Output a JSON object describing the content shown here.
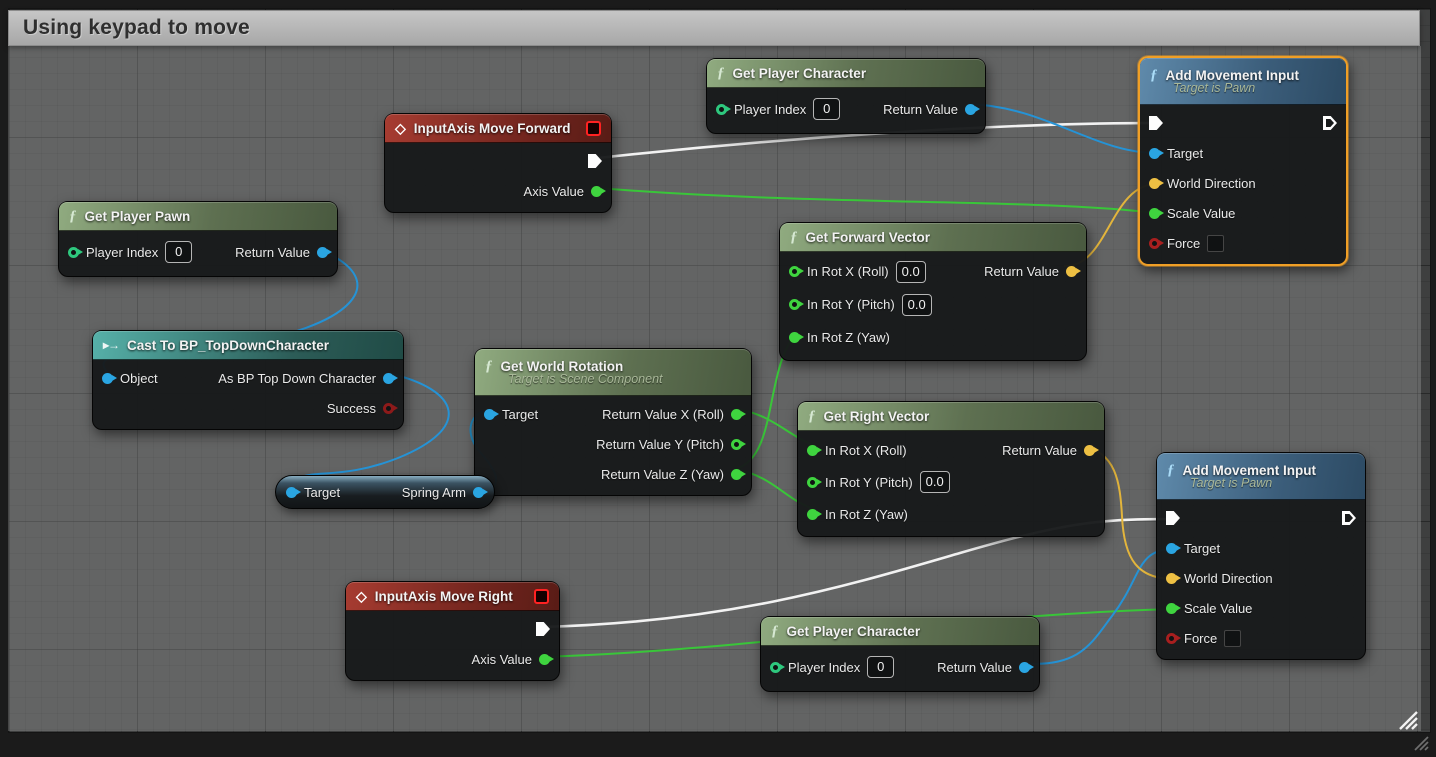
{
  "comment": {
    "title": "Using keypad to move"
  },
  "icons": {
    "function": "ƒ",
    "event": "◇",
    "cast": "▸→"
  },
  "colors": {
    "selection_orange": "#f09f26",
    "wire_exec": "#f2f2f2",
    "wire_object": "#2593d6",
    "wire_float": "#39c639",
    "wire_vector": "#e3b53c",
    "header_function": "#6f8a5f",
    "header_event": "#a73c31",
    "header_cast": "#3f968e",
    "header_pure": "#4a7396",
    "comment_bar": "#b5b5b5"
  },
  "nodes": {
    "get_player_character_top": {
      "title": "Get Player Character",
      "pins": {
        "player_index": "Player Index",
        "player_index_value": "0",
        "return_value": "Return Value"
      }
    },
    "input_axis_move_forward": {
      "title": "InputAxis Move Forward",
      "pins": {
        "axis_value": "Axis Value"
      }
    },
    "add_movement_input_top": {
      "title": "Add Movement Input",
      "subtitle": "Target is Pawn",
      "pins": {
        "target": "Target",
        "world_direction": "World Direction",
        "scale_value": "Scale Value",
        "force": "Force"
      }
    },
    "get_player_pawn": {
      "title": "Get Player Pawn",
      "pins": {
        "player_index": "Player Index",
        "player_index_value": "0",
        "return_value": "Return Value"
      }
    },
    "get_forward_vector": {
      "title": "Get Forward Vector",
      "pins": {
        "in_rot_x": "In Rot X (Roll)",
        "in_rot_x_value": "0.0",
        "in_rot_y": "In Rot Y (Pitch)",
        "in_rot_y_value": "0.0",
        "in_rot_z": "In Rot Z (Yaw)",
        "return_value": "Return Value"
      }
    },
    "cast_to_bp_topdowncharacter": {
      "title": "Cast To BP_TopDownCharacter",
      "pins": {
        "object": "Object",
        "as_character": "As BP Top Down Character",
        "success": "Success"
      }
    },
    "get_world_rotation": {
      "title": "Get World Rotation",
      "subtitle": "Target is Scene Component",
      "pins": {
        "target": "Target",
        "return_x": "Return Value X (Roll)",
        "return_y": "Return Value Y (Pitch)",
        "return_z": "Return Value Z (Yaw)"
      }
    },
    "get_right_vector": {
      "title": "Get Right Vector",
      "pins": {
        "in_rot_x": "In Rot X (Roll)",
        "in_rot_y": "In Rot Y (Pitch)",
        "in_rot_y_value": "0.0",
        "in_rot_z": "In Rot Z (Yaw)",
        "return_value": "Return Value"
      }
    },
    "spring_arm_getter": {
      "pins": {
        "target": "Target",
        "spring_arm": "Spring Arm"
      }
    },
    "input_axis_move_right": {
      "title": "InputAxis Move Right",
      "pins": {
        "axis_value": "Axis Value"
      }
    },
    "get_player_character_bottom": {
      "title": "Get Player Character",
      "pins": {
        "player_index": "Player Index",
        "player_index_value": "0",
        "return_value": "Return Value"
      }
    },
    "add_movement_input_bottom": {
      "title": "Add Movement Input",
      "subtitle": "Target is Pawn",
      "pins": {
        "target": "Target",
        "world_direction": "World Direction",
        "scale_value": "Scale Value",
        "force": "Force"
      }
    }
  }
}
